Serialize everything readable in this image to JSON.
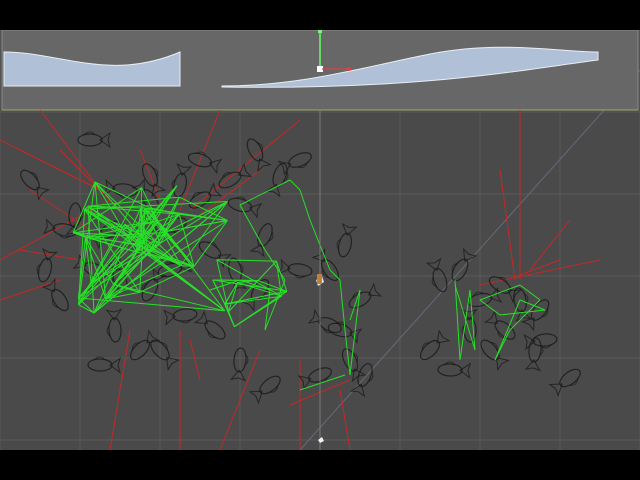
{
  "window": {
    "title": "",
    "background_color": "#4a4a4a",
    "letterbox_color": "#000000"
  },
  "curve_editor": {
    "panel_color": "#676767",
    "curve_fill_color": "#b0c0d6",
    "curve_line_color": "#e9eef5",
    "axis_color": "#9db36a",
    "key_handle_color": "#e04040",
    "vertical_handle_color": "#66ff66"
  },
  "scene": {
    "grid_color": "#5a5a5a",
    "diagonal_color": "#666a7a",
    "connection_line_color": "#28e028",
    "ray_color": "#c42828",
    "fish_color": "#1b1b1b",
    "gizmo_icon": "camera-gizmo-icon"
  }
}
